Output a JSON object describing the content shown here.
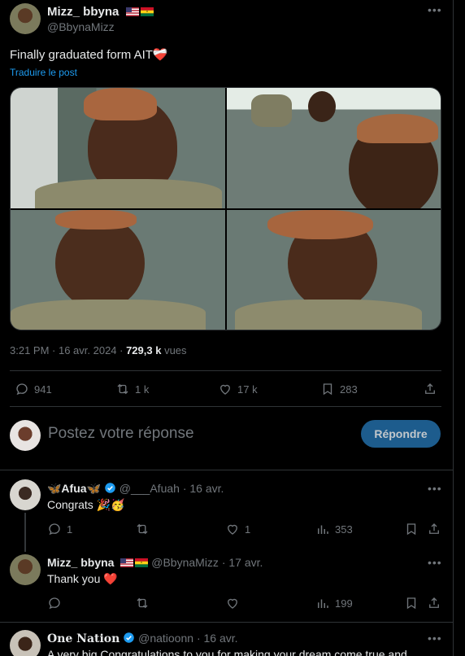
{
  "post": {
    "author_name": "Mizz_ bbyna",
    "author_handle": "@BbynaMizz",
    "text": "Finally graduated form AIT",
    "text_emoji": "❤️‍🩹",
    "translate_link": "Traduire le post",
    "timestamp": "3:21 PM · 16 avr. 2024 · ",
    "views_count": "729,3 k",
    "views_label": " vues",
    "actions": {
      "replies": "941",
      "reposts": "1 k",
      "likes": "17 k",
      "bookmarks": "283"
    }
  },
  "composer": {
    "placeholder": "Postez votre réponse",
    "reply_button": "Répondre"
  },
  "replies": [
    {
      "name": "🦋Afua🦋",
      "verified": true,
      "handle": "@___Afuah",
      "date": "· 16 avr.",
      "text": "Congrats 🎉🥳",
      "replies": "1",
      "likes": "1",
      "views": "353"
    },
    {
      "name": "Mizz_ bbyna",
      "handle": "@BbynaMizz",
      "date": "· 17 avr.",
      "text": "Thank you ❤️",
      "views": "199"
    },
    {
      "name": "One Nation",
      "verified": true,
      "handle": "@natioonn",
      "date": "· 16 avr.",
      "text": "A very big Congratulations to you for making your dream come true and"
    }
  ],
  "colors": {
    "background": "#000000",
    "text": "#e7e9ea",
    "muted": "#71767b",
    "link": "#1d9bf0",
    "border": "#2f3336",
    "button": "#1d5c8d",
    "heart": "#f91880"
  },
  "icons": [
    "reply-icon",
    "repost-icon",
    "like-icon",
    "bookmark-icon",
    "share-icon",
    "views-icon",
    "more-icon",
    "verified-icon",
    "flag-us-icon",
    "flag-ghana-icon"
  ]
}
